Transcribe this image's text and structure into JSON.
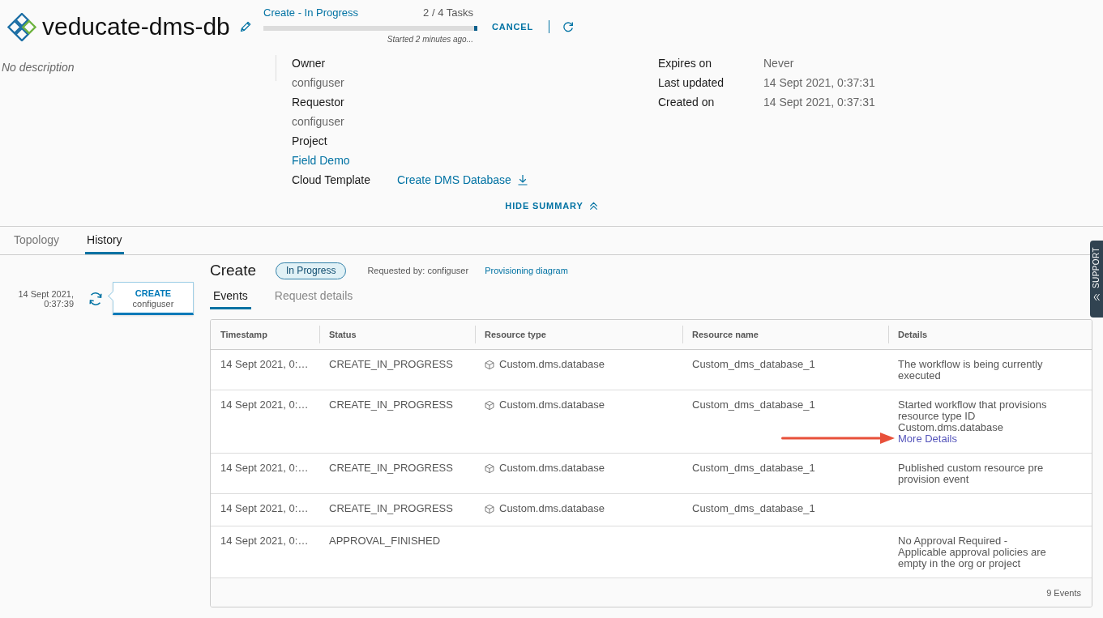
{
  "header": {
    "title": "veducate-dms-db",
    "progress": {
      "status": "Create - In Progress",
      "tasks": "2 / 4 Tasks",
      "level": 1,
      "started": "Started 2 minutes ago...",
      "cancel": "CANCEL"
    }
  },
  "summary": {
    "description": "No description",
    "fields": [
      {
        "kind": "text",
        "label": "Owner",
        "value": "configuser"
      },
      {
        "kind": "text",
        "label": "Requestor",
        "value": "configuser"
      },
      {
        "kind": "link",
        "label": "Project",
        "value": "Field Demo"
      },
      {
        "kind": "download-link",
        "label": "Cloud Template",
        "value": "Create DMS Database"
      }
    ],
    "dates": [
      {
        "label": "Expires on",
        "value": "Never"
      },
      {
        "label": "Last updated",
        "value": "14 Sept 2021, 0:37:31"
      },
      {
        "label": "Created on",
        "value": "14 Sept 2021, 0:37:31"
      }
    ],
    "toggle": "HIDE SUMMARY"
  },
  "tabs": [
    {
      "label": "Topology",
      "selected": false
    },
    {
      "label": "History",
      "selected": true
    }
  ],
  "history": {
    "timeline": [
      {
        "date": "14 Sept 2021, 0:37:39",
        "action": "CREATE",
        "user": "configuser",
        "selected": true
      }
    ],
    "request": {
      "title": "Create",
      "status": "In Progress",
      "requested_by": "Requested by: configuser",
      "diagram_link": "Provisioning diagram"
    },
    "tabs": [
      {
        "label": "Events",
        "selected": true
      },
      {
        "label": "Request details",
        "selected": false
      }
    ],
    "events": {
      "columns": [
        "Timestamp",
        "Status",
        "Resource type",
        "Resource name",
        "Details"
      ],
      "rows": [
        {
          "timestamp": "14 Sept 2021, 0:…",
          "status": "CREATE_IN_PROGRESS",
          "resource_type": "Custom.dms.database",
          "resource_name": "Custom_dms_database_1",
          "details": "The workflow is being currently executed",
          "annotated": false
        },
        {
          "timestamp": "14 Sept 2021, 0:…",
          "status": "CREATE_IN_PROGRESS",
          "resource_type": "Custom.dms.database",
          "resource_name": "Custom_dms_database_1",
          "details": "Started workflow that provisions resource type ID Custom.dms.database",
          "link": "More Details",
          "annotated": true
        },
        {
          "timestamp": "14 Sept 2021, 0:…",
          "status": "CREATE_IN_PROGRESS",
          "resource_type": "Custom.dms.database",
          "resource_name": "Custom_dms_database_1",
          "details": "Published custom resource pre provision event",
          "annotated": false
        },
        {
          "timestamp": "14 Sept 2021, 0:…",
          "status": "CREATE_IN_PROGRESS",
          "resource_type": "Custom.dms.database",
          "resource_name": "Custom_dms_database_1",
          "annotated": false
        },
        {
          "timestamp": "14 Sept 2021, 0:…",
          "status": "APPROVAL_FINISHED",
          "details": "No Approval Required - Applicable approval policies are empty in the org or project",
          "annotated": false
        }
      ],
      "footer": "9 Events"
    }
  },
  "support_tab": {
    "label": "SUPPORT"
  }
}
